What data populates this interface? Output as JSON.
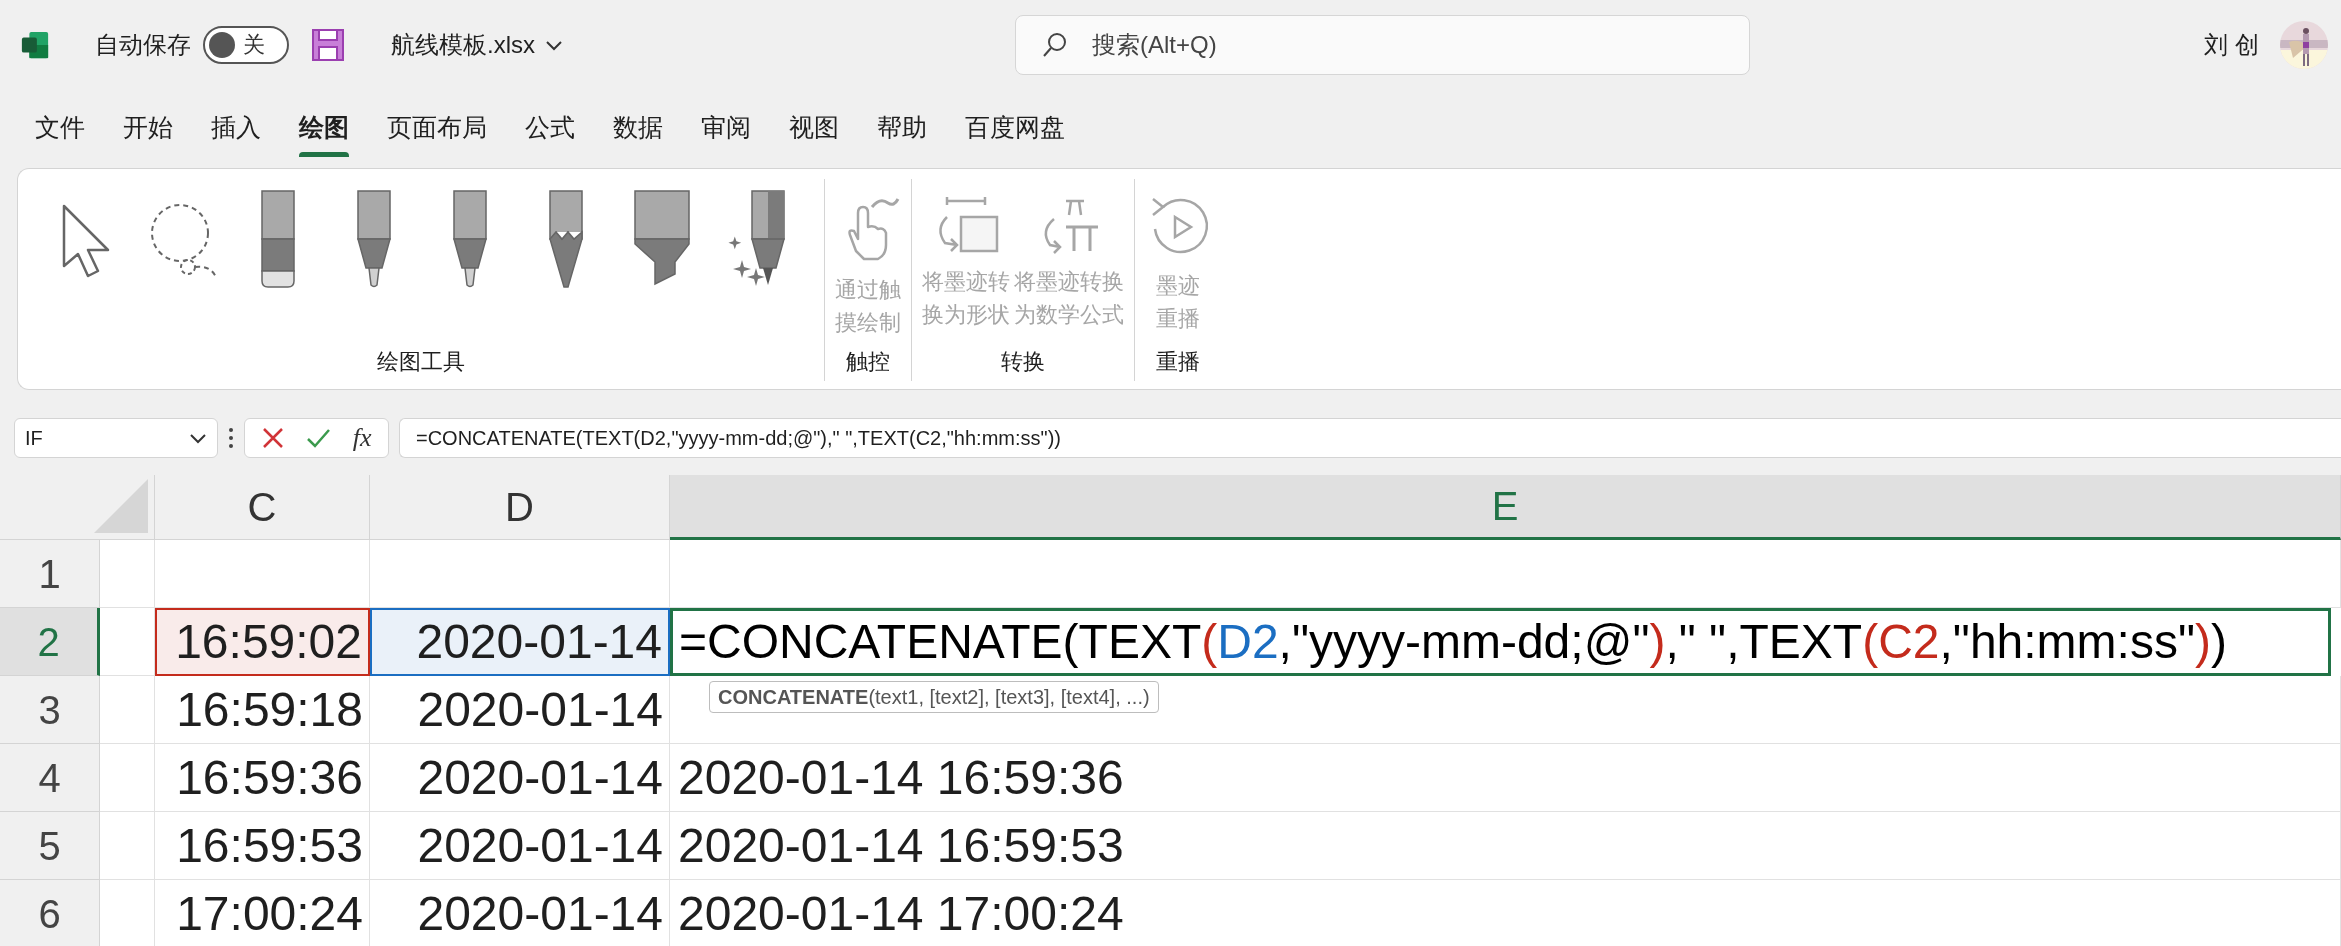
{
  "title_bar": {
    "autosave_label": "自动保存",
    "autosave_toggle": {
      "on": false,
      "label": "关"
    },
    "file_name": "航线模板.xlsx",
    "search": {
      "placeholder": "搜索(Alt+Q)"
    },
    "user_name": "刘 创"
  },
  "tabs": [
    {
      "label": "文件",
      "selected": false
    },
    {
      "label": "开始",
      "selected": false
    },
    {
      "label": "插入",
      "selected": false
    },
    {
      "label": "绘图",
      "selected": true
    },
    {
      "label": "页面布局",
      "selected": false
    },
    {
      "label": "公式",
      "selected": false
    },
    {
      "label": "数据",
      "selected": false
    },
    {
      "label": "审阅",
      "selected": false
    },
    {
      "label": "视图",
      "selected": false
    },
    {
      "label": "帮助",
      "selected": false
    },
    {
      "label": "百度网盘",
      "selected": false
    }
  ],
  "ribbon": {
    "groups": [
      {
        "label": "绘图工具",
        "tools": [
          {
            "kind": "select"
          },
          {
            "kind": "lasso"
          },
          {
            "kind": "eraser"
          },
          {
            "kind": "pen"
          },
          {
            "kind": "pen"
          },
          {
            "kind": "pencil"
          },
          {
            "kind": "highlighter"
          },
          {
            "kind": "action-pen"
          }
        ]
      },
      {
        "label": "触控",
        "buttons": [
          {
            "kind": "touch",
            "label": "通过触摸绘制",
            "disabled": true
          }
        ]
      },
      {
        "label": "转换",
        "buttons": [
          {
            "kind": "ink-to-shape",
            "label": "将墨迹转换为形状",
            "disabled": true
          },
          {
            "kind": "ink-to-math",
            "label": "将墨迹转换为数学公式",
            "disabled": true
          }
        ]
      },
      {
        "label": "重播",
        "buttons": [
          {
            "kind": "replay",
            "label": "墨迹重播",
            "disabled": true
          }
        ]
      }
    ]
  },
  "formula_bar": {
    "name_box": "IF",
    "function_label": "fx",
    "formula": "=CONCATENATE(TEXT(D2,\"yyyy-mm-dd;@\"),\" \",TEXT(C2,\"hh:mm:ss\"))"
  },
  "sheet": {
    "columns": [
      {
        "label": "C",
        "selected": false
      },
      {
        "label": "D",
        "selected": false
      },
      {
        "label": "E",
        "selected": true
      }
    ],
    "rows": [
      {
        "header": "1",
        "selected": false
      },
      {
        "header": "2",
        "selected": true,
        "cells": [
          {
            "kind": "value",
            "text": "16:59:02",
            "color": "#c42b1c"
          },
          {
            "kind": "value",
            "text": "2020-01-14",
            "color": "#1b6ec2"
          },
          {
            "kind": "editing",
            "segments": [
              {
                "text": "=CONCATENATE(TEXT",
                "color": "#000000"
              },
              {
                "text": "(",
                "color": "#c42b1c"
              },
              {
                "text": "D2",
                "color": "#1b6ec2"
              },
              {
                "text": ",\"yyyy-mm-dd;@\"",
                "color": "#000000"
              },
              {
                "text": ")",
                "color": "#c42b1c"
              },
              {
                "text": ",\" \",TEXT",
                "color": "#000000"
              },
              {
                "text": "(",
                "color": "#c42b1c"
              },
              {
                "text": "C2",
                "color": "#c42b1c"
              },
              {
                "text": ",\"hh:mm:ss\"",
                "color": "#000000"
              },
              {
                "text": ")",
                "color": "#c42b1c"
              },
              {
                "text": ")",
                "color": "#000000"
              }
            ]
          }
        ]
      },
      {
        "header": "3",
        "selected": false,
        "cells": [
          {
            "kind": "value",
            "text": "16:59:18"
          },
          {
            "kind": "value",
            "text": "2020-01-14"
          }
        ]
      },
      {
        "header": "4",
        "selected": false,
        "cells": [
          {
            "kind": "value",
            "text": "16:59:36"
          },
          {
            "kind": "value",
            "text": "2020-01-14"
          },
          {
            "kind": "value",
            "text": "2020-01-14 16:59:36"
          }
        ]
      },
      {
        "header": "5",
        "selected": false,
        "cells": [
          {
            "kind": "value",
            "text": "16:59:53"
          },
          {
            "kind": "value",
            "text": "2020-01-14"
          },
          {
            "kind": "value",
            "text": "2020-01-14 16:59:53"
          }
        ]
      },
      {
        "header": "6",
        "selected": false,
        "cells": [
          {
            "kind": "value",
            "text": "17:00:24"
          },
          {
            "kind": "value",
            "text": "2020-01-14"
          },
          {
            "kind": "value",
            "text": "2020-01-14 17:00:24"
          }
        ]
      }
    ],
    "tooltip": "**CONCATENATE**(text1, [text2], [text3], [text4], ...)"
  }
}
